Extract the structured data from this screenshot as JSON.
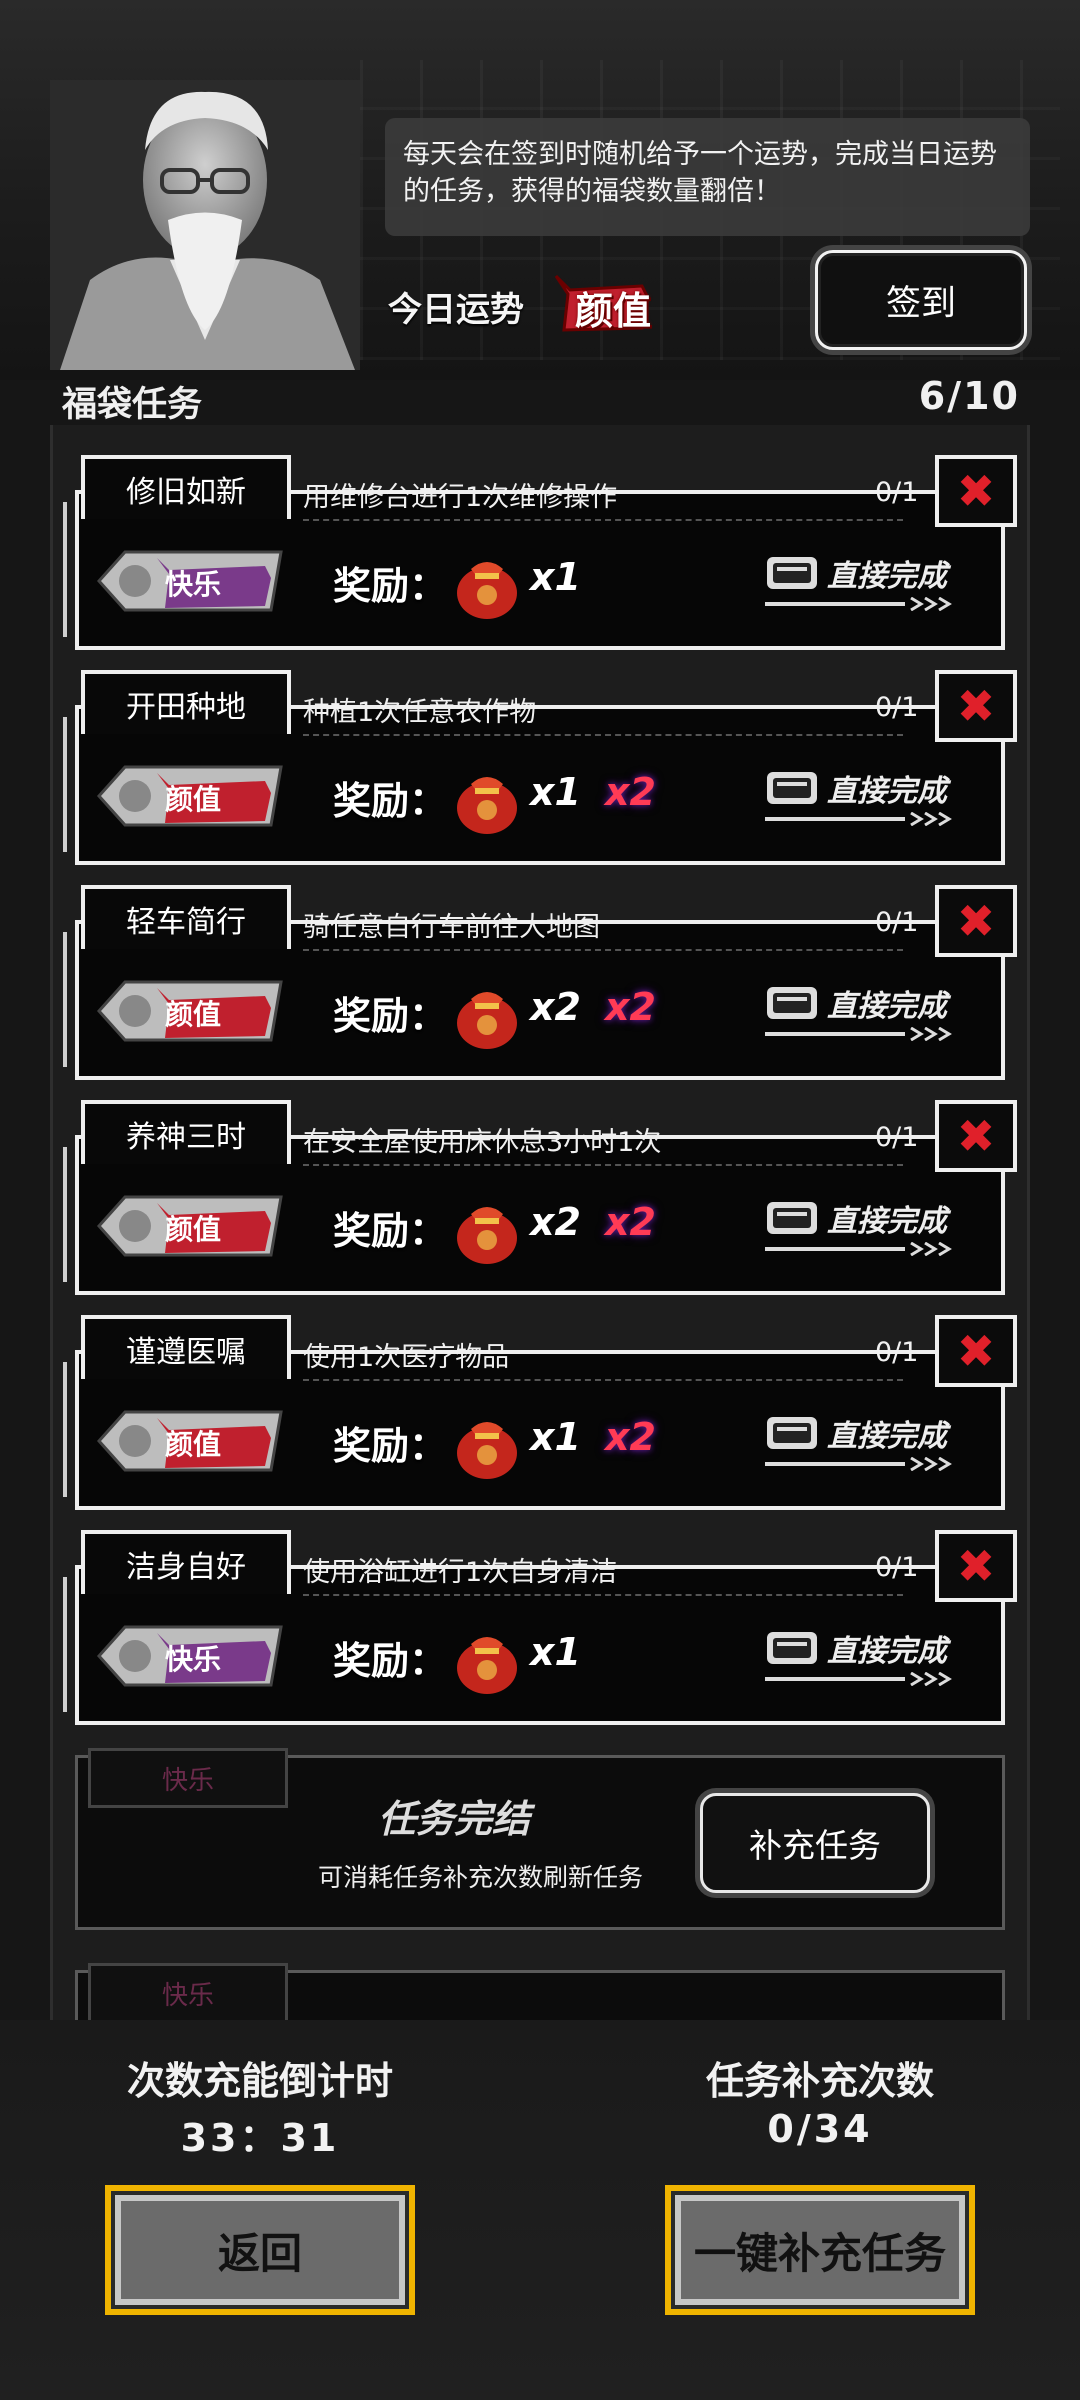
{
  "header": {
    "tip": "每天会在签到时随机给予一个运势，完成当日运势的任务，获得的福袋数量翻倍！",
    "fortune_label": "今日运势",
    "fortune_value": "颜值",
    "signin_label": "签到"
  },
  "section": {
    "title": "福袋任务",
    "count": "6/10"
  },
  "reward_label": "奖励：",
  "complete_label": "直接完成",
  "tasks": [
    {
      "title": "修旧如新",
      "desc": "用维修台进行1次维修操作",
      "progress": "0/1",
      "tag": "快乐",
      "tag_color": "#7a3a8a",
      "qty": "x1",
      "mult": ""
    },
    {
      "title": "开田种地",
      "desc": "种植1次任意农作物",
      "progress": "0/1",
      "tag": "颜值",
      "tag_color": "#c0202e",
      "qty": "x1",
      "mult": "x2"
    },
    {
      "title": "轻车简行",
      "desc": "骑任意自行车前往大地图",
      "progress": "0/1",
      "tag": "颜值",
      "tag_color": "#c0202e",
      "qty": "x2",
      "mult": "x2"
    },
    {
      "title": "养神三时",
      "desc": "在安全屋使用床休息3小时1次",
      "progress": "0/1",
      "tag": "颜值",
      "tag_color": "#c0202e",
      "qty": "x2",
      "mult": "x2"
    },
    {
      "title": "谨遵医嘱",
      "desc": "使用1次医疗物品",
      "progress": "0/1",
      "tag": "颜值",
      "tag_color": "#c0202e",
      "qty": "x1",
      "mult": "x2"
    },
    {
      "title": "洁身自好",
      "desc": "使用浴缸进行1次自身清洁",
      "progress": "0/1",
      "tag": "快乐",
      "tag_color": "#7a3a8a",
      "qty": "x1",
      "mult": ""
    }
  ],
  "finished": {
    "tag": "快乐",
    "title": "任务完结",
    "sub": "可消耗任务补充次数刷新任务",
    "button": "补充任务"
  },
  "footer": {
    "countdown_label": "次数充能倒计时",
    "countdown_value": "33：31",
    "refill_label": "任务补充次数",
    "refill_value": "0/34",
    "back_button": "返回",
    "refill_all_button": "一键补充任务"
  }
}
